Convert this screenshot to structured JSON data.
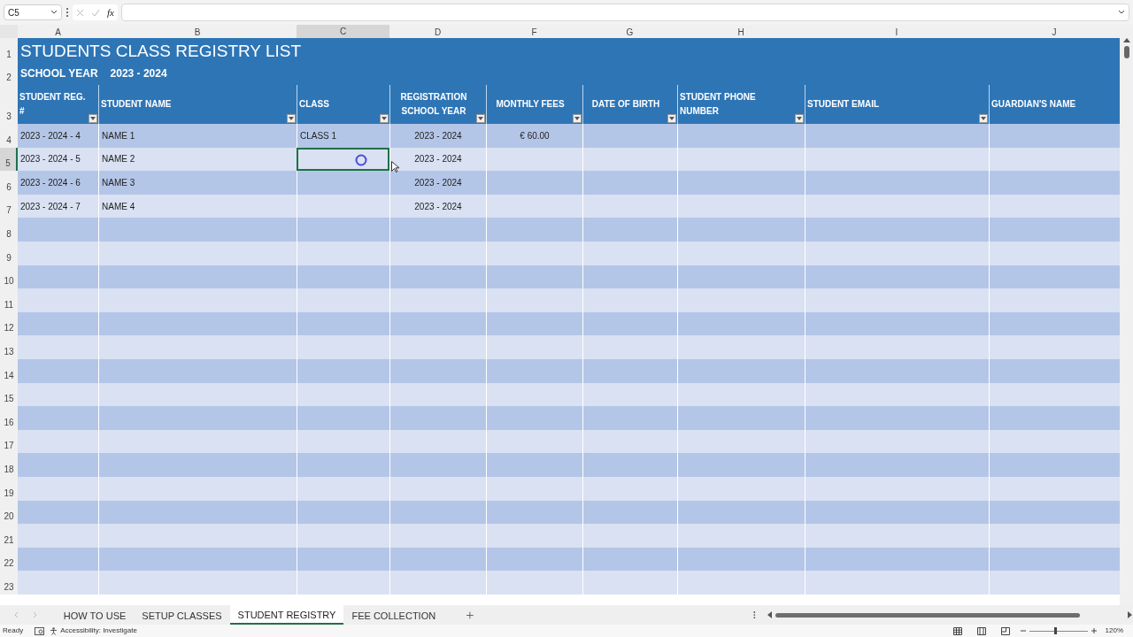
{
  "formula_bar": {
    "name_box": "C5",
    "function_label": "fx"
  },
  "column_headers": [
    {
      "label": "A",
      "selected": false
    },
    {
      "label": "B",
      "selected": false
    },
    {
      "label": "C",
      "selected": true
    },
    {
      "label": "D",
      "selected": false
    },
    {
      "label": "F",
      "selected": false
    },
    {
      "label": "G",
      "selected": false
    },
    {
      "label": "H",
      "selected": false
    },
    {
      "label": "I",
      "selected": false
    },
    {
      "label": "J",
      "selected": false
    }
  ],
  "title": "STUDENTS CLASS REGISTRY LIST",
  "school_year": {
    "label": "SCHOOL YEAR",
    "value": "2023 - 2024"
  },
  "table": {
    "columns": [
      {
        "label": "STUDENT REG. #",
        "filter": true
      },
      {
        "label": "STUDENT NAME",
        "filter": true
      },
      {
        "label": "CLASS",
        "filter": true
      },
      {
        "label": "REGISTRATION SCHOOL YEAR",
        "filter": true
      },
      {
        "label": "MONTHLY FEES",
        "filter": true
      },
      {
        "label": "DATE OF BIRTH",
        "filter": true
      },
      {
        "label": "STUDENT PHONE NUMBER",
        "filter": true
      },
      {
        "label": "STUDENT EMAIL",
        "filter": true
      },
      {
        "label": "GUARDIAN'S NAME",
        "filter": false
      }
    ],
    "rows": [
      {
        "row": "4",
        "selected": false,
        "cells": [
          "2023 - 2024 - 4",
          "NAME 1",
          "CLASS 1",
          "2023 - 2024",
          "€ 60.00"
        ]
      },
      {
        "row": "5",
        "selected": true,
        "cells": [
          "2023 - 2024 - 5",
          "NAME 2",
          null,
          "2023 - 2024"
        ]
      },
      {
        "row": "6",
        "selected": false,
        "cells": [
          "2023 - 2024 - 6",
          "NAME 3",
          null,
          "2023 - 2024"
        ]
      },
      {
        "row": "7",
        "selected": false,
        "cells": [
          "2023 - 2024 - 7",
          "NAME 4",
          null,
          "2023 - 2024"
        ]
      },
      {
        "row": "8",
        "selected": false,
        "cells": []
      },
      {
        "row": "9",
        "selected": false,
        "cells": []
      },
      {
        "row": "10",
        "selected": false,
        "cells": []
      },
      {
        "row": "11",
        "selected": false,
        "cells": []
      },
      {
        "row": "12",
        "selected": false,
        "cells": []
      },
      {
        "row": "13",
        "selected": false,
        "cells": []
      },
      {
        "row": "14",
        "selected": false,
        "cells": []
      },
      {
        "row": "15",
        "selected": false,
        "cells": []
      },
      {
        "row": "16",
        "selected": false,
        "cells": []
      },
      {
        "row": "17",
        "selected": false,
        "cells": []
      },
      {
        "row": "18",
        "selected": false,
        "cells": []
      },
      {
        "row": "19",
        "selected": false,
        "cells": []
      },
      {
        "row": "20",
        "selected": false,
        "cells": []
      },
      {
        "row": "21",
        "selected": false,
        "cells": []
      },
      {
        "row": "22",
        "selected": false,
        "cells": []
      },
      {
        "row": "23",
        "selected": false,
        "cells": []
      }
    ]
  },
  "top_row_headers": [
    "1",
    "2",
    "3"
  ],
  "sheet_tabs": [
    {
      "label": "HOW TO USE",
      "selected": false
    },
    {
      "label": "SETUP CLASSES",
      "selected": false
    },
    {
      "label": "STUDENT REGISTRY",
      "selected": true
    },
    {
      "label": "FEE COLLECTION",
      "selected": false
    }
  ],
  "status_bar": {
    "status": "Ready",
    "accessibility": "Accessibility: Investigate",
    "zoom": {
      "level": 0.45,
      "reading": "120%"
    }
  }
}
